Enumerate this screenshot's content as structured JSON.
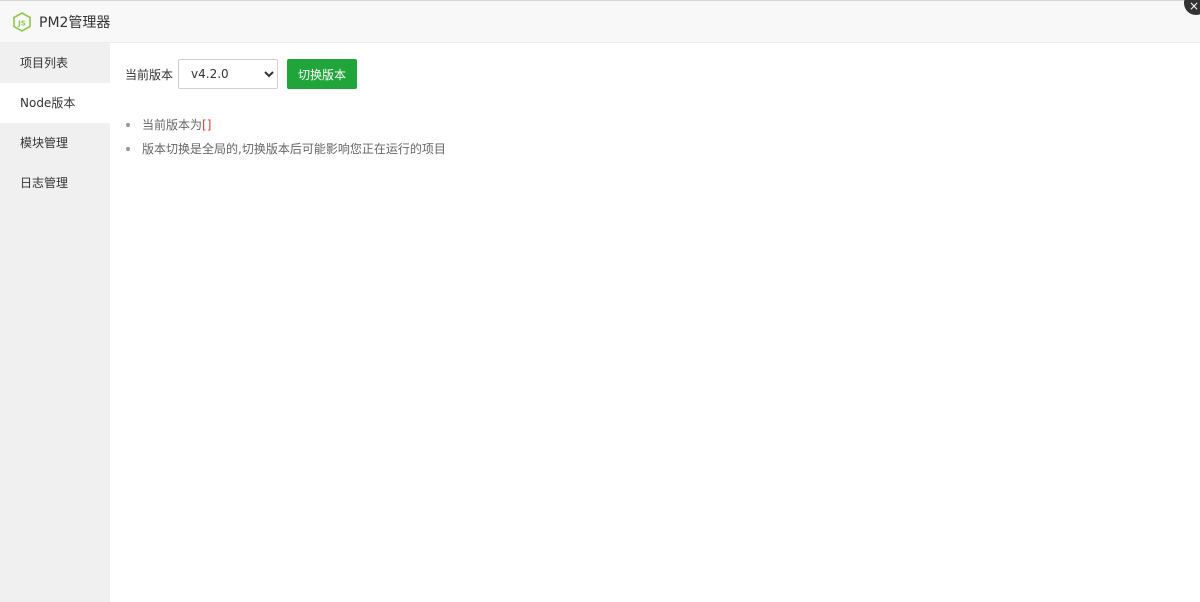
{
  "window": {
    "title": "PM2管理器",
    "close_glyph": "×"
  },
  "sidebar": {
    "items": [
      {
        "label": "项目列表"
      },
      {
        "label": "Node版本"
      },
      {
        "label": "模块管理"
      },
      {
        "label": "日志管理"
      }
    ],
    "active_index": 1
  },
  "main": {
    "version_label": "当前版本",
    "version_select": {
      "selected": "v4.2.0"
    },
    "switch_button": "切换版本",
    "tips": {
      "current_version_prefix": "当前版本为",
      "current_version_value": "[]",
      "warning": "版本切换是全局的,切换版本后可能影响您正在运行的项目"
    }
  },
  "colors": {
    "accent": "#20a53a",
    "highlight": "#e4393c",
    "sidebar_bg": "#f0f0f0"
  },
  "icons": {
    "app_logo": "nodejs-icon",
    "close": "close-icon"
  }
}
